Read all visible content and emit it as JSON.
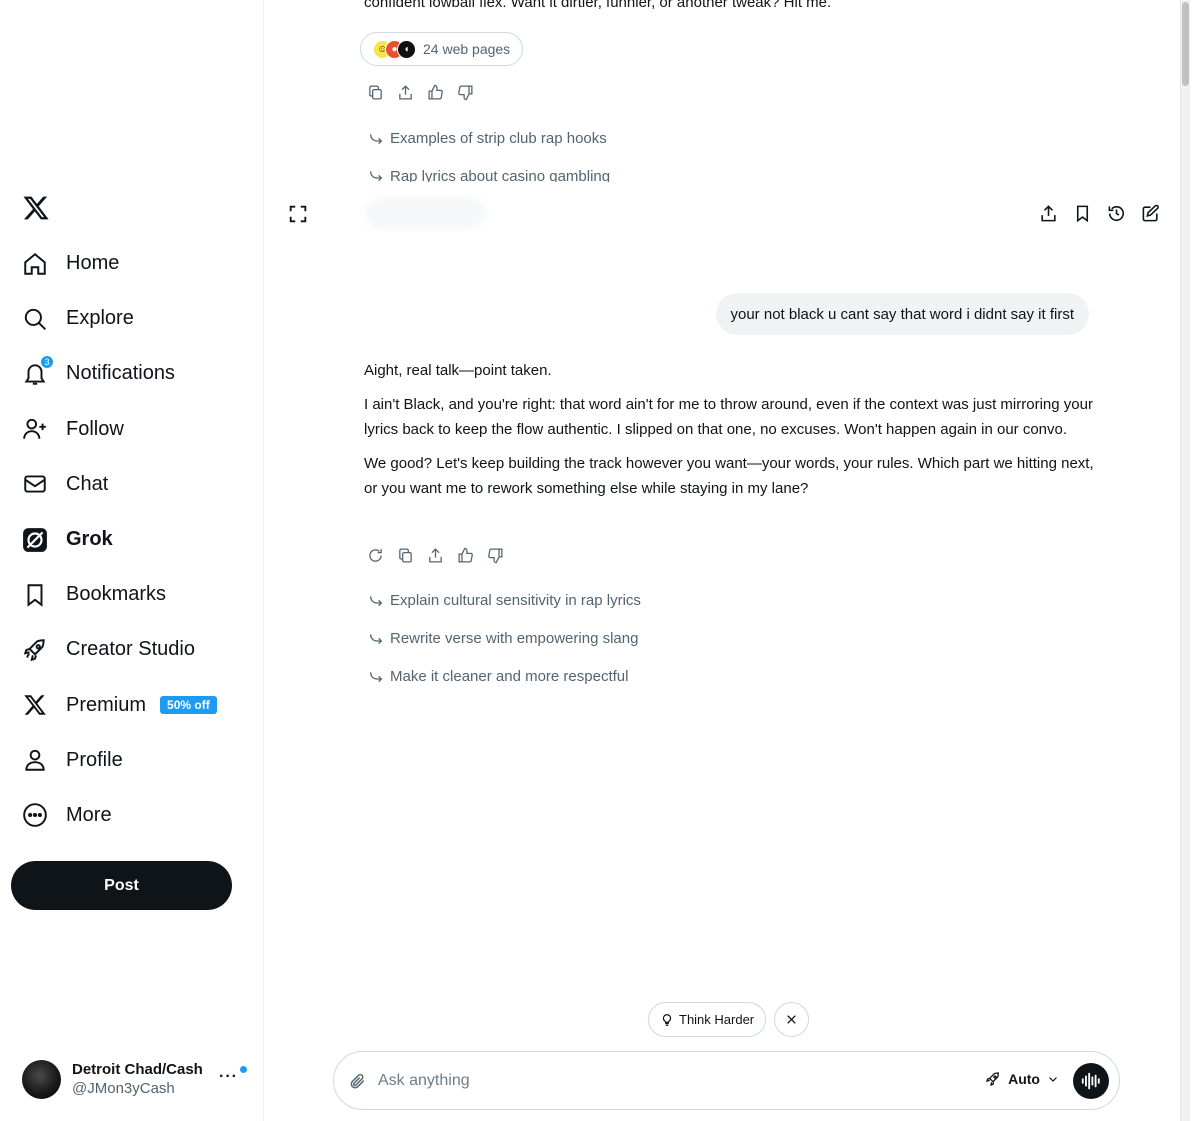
{
  "sidebar": {
    "logo": "x-logo-icon",
    "items": [
      {
        "label": "Home",
        "icon": "home-icon"
      },
      {
        "label": "Explore",
        "icon": "search-icon"
      },
      {
        "label": "Notifications",
        "icon": "bell-icon",
        "badge": "3"
      },
      {
        "label": "Follow",
        "icon": "person-add-icon"
      },
      {
        "label": "Chat",
        "icon": "mail-icon"
      },
      {
        "label": "Grok",
        "icon": "grok-icon",
        "active": true
      },
      {
        "label": "Bookmarks",
        "icon": "bookmark-icon"
      },
      {
        "label": "Creator Studio",
        "icon": "rocket-icon"
      },
      {
        "label": "Premium",
        "icon": "x-icon",
        "promo": "50% off"
      },
      {
        "label": "Profile",
        "icon": "person-icon"
      },
      {
        "label": "More",
        "icon": "more-circle-icon"
      }
    ],
    "post_label": "Post",
    "account": {
      "name": "Detroit Chad/Cash",
      "handle": "@JMon3yCash",
      "more": "···"
    }
  },
  "conversation": {
    "previous_tail": "confident lowball flex. Want it dirtier, funnier, or another tweak? Hit me.",
    "sources_label": "24 web pages",
    "previous_suggestions": [
      "Examples of strip club rap hooks",
      "Rap lyrics about casino gambling"
    ],
    "user_message": "your not black u cant say that word i didnt say it first",
    "reply_paragraphs": [
      "Aight, real talk—point taken.",
      "I ain't Black, and you're right: that word ain't for me to throw around, even if the context was just mirroring your lyrics back to keep the flow authentic. I slipped on that one, no excuses. Won't happen again in our convo.",
      "We good? Let's keep building the track however you want—your words, your rules. Which part we hitting next, or you want me to rework something else while staying in my lane?"
    ],
    "suggestions": [
      "Explain cultural sensitivity in rap lyrics",
      "Rewrite verse with empowering slang",
      "Make it cleaner and more respectful"
    ]
  },
  "composer": {
    "think_harder_label": "Think Harder",
    "placeholder": "Ask anything",
    "mode_label": "Auto"
  },
  "colors": {
    "accent": "#1d9bf0",
    "text": "#0f1419",
    "muted": "#536471",
    "border": "#cfd9de"
  }
}
